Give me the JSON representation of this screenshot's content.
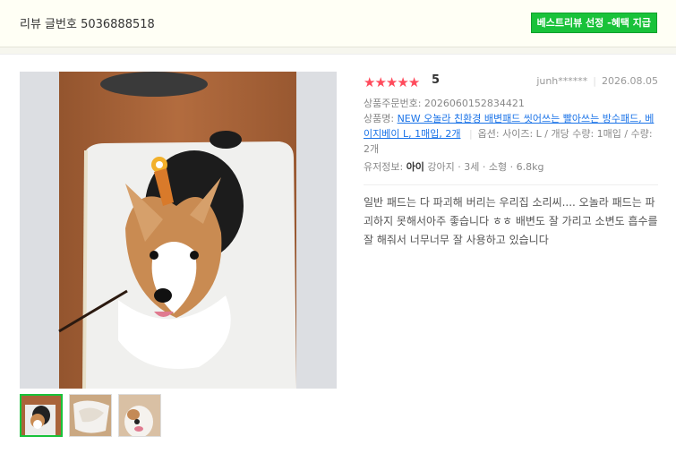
{
  "header": {
    "review_no_label": "리뷰 글번호 5036888518",
    "best_badge": "베스트리뷰 선정 -혜택 지급"
  },
  "review": {
    "rating": "5",
    "stars": 5,
    "author": "junh******",
    "date": "2026.08.05",
    "order_no": "상품주문번호: 2026060152834421",
    "product_prefix": "상품명: ",
    "product_link": "NEW 오놀라 친환경 배변패드 씻어쓰는 빨아쓰는 방수패드, 베이지베이 L, 1매입, 2개",
    "option_sep": "|",
    "option_text": "옵션: 사이즈: L / 개당 수량: 1매입 / 수량: 2개",
    "pet_prefix": "유저정보: ",
    "pet_name": "아이",
    "pet_details": " 강아지 · 3세 · 소형 · 6.8kg",
    "content": "일반 패드는 다 파괴해 버리는 우리집 소리씨.... 오놀라 패드는 파괴하지 못해서아주 좋습니다 ㅎㅎ 배변도 잘 가리고 소변도 흡수를 잘 해줘서 너무너무 잘 사용하고 있습니다"
  },
  "icons": {
    "star": "star-icon"
  },
  "colors": {
    "badge": "#19c23a",
    "star": "#ff4b5c",
    "link": "#1a73e8"
  }
}
